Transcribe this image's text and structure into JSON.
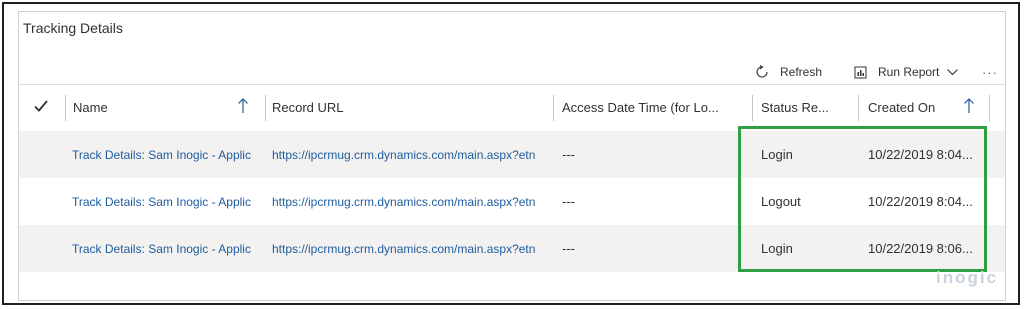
{
  "section": {
    "title": "Tracking Details"
  },
  "commands": {
    "refresh": {
      "label": "Refresh",
      "icon": "refresh-icon"
    },
    "run_report": {
      "label": "Run Report",
      "icon": "report-icon",
      "chevron": "chevron-down-icon"
    },
    "more": {
      "label": "···",
      "icon": "more-icon"
    }
  },
  "columns": [
    {
      "label": "Name",
      "sorted": "ascending"
    },
    {
      "label": "Record URL"
    },
    {
      "label": "Access Date Time (for Lo..."
    },
    {
      "label": "Status Re..."
    },
    {
      "label": "Created On",
      "sorted": "ascending"
    }
  ],
  "rows": [
    {
      "name": "Track Details: Sam Inogic - Applic",
      "url": "https://ipcrmug.crm.dynamics.com/main.aspx?etn",
      "access": "---",
      "status": "Login",
      "created": "10/22/2019 8:04..."
    },
    {
      "name": "Track Details: Sam Inogic - Applic",
      "url": "https://ipcrmug.crm.dynamics.com/main.aspx?etn",
      "access": "---",
      "status": "Logout",
      "created": "10/22/2019 8:04..."
    },
    {
      "name": "Track Details: Sam Inogic - Applic",
      "url": "https://ipcrmug.crm.dynamics.com/main.aspx?etn",
      "access": "---",
      "status": "Login",
      "created": "10/22/2019 8:06..."
    }
  ],
  "watermark": "inogic",
  "colors": {
    "link": "#1e5c9e",
    "highlight": "#2ea043",
    "row_shade": "#f3f2f1"
  }
}
